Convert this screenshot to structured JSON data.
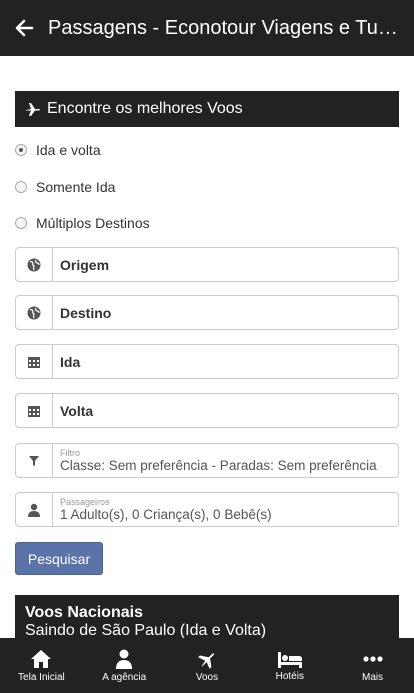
{
  "appbar": {
    "title": "Passagens - Econotour Viagens e Turismo"
  },
  "search": {
    "header": "Encontre os melhores Voos",
    "trip_types": [
      "Ida e volta",
      "Somente Ida",
      "Múltiplos Destinos"
    ],
    "selected_trip_type": "Ida e volta",
    "origin_placeholder": "Origem",
    "destination_placeholder": "Destino",
    "departure_placeholder": "Ida",
    "return_placeholder": "Volta",
    "filter_label": "Filtro",
    "filter_value": "Classe: Sem preferência - Paradas: Sem preferência",
    "passengers_label": "Passageiros",
    "passengers_value": "1 Adulto(s), 0 Criança(s), 0 Bebê(s)",
    "submit_label": "Pesquisar"
  },
  "promo": {
    "title": "Voos Nacionais",
    "subtitle": "Saindo de São Paulo (Ida e Volta)"
  },
  "navbar": {
    "items": [
      {
        "label": "Tela Inicial",
        "icon": "home-icon"
      },
      {
        "label": "A agência",
        "icon": "user-icon"
      },
      {
        "label": "Voos",
        "icon": "plane-icon"
      },
      {
        "label": "Hotéis",
        "icon": "bed-icon"
      },
      {
        "label": "Mais",
        "icon": "more-icon"
      }
    ]
  },
  "colors": {
    "dark": "#222222",
    "button": "#5a73a8"
  }
}
